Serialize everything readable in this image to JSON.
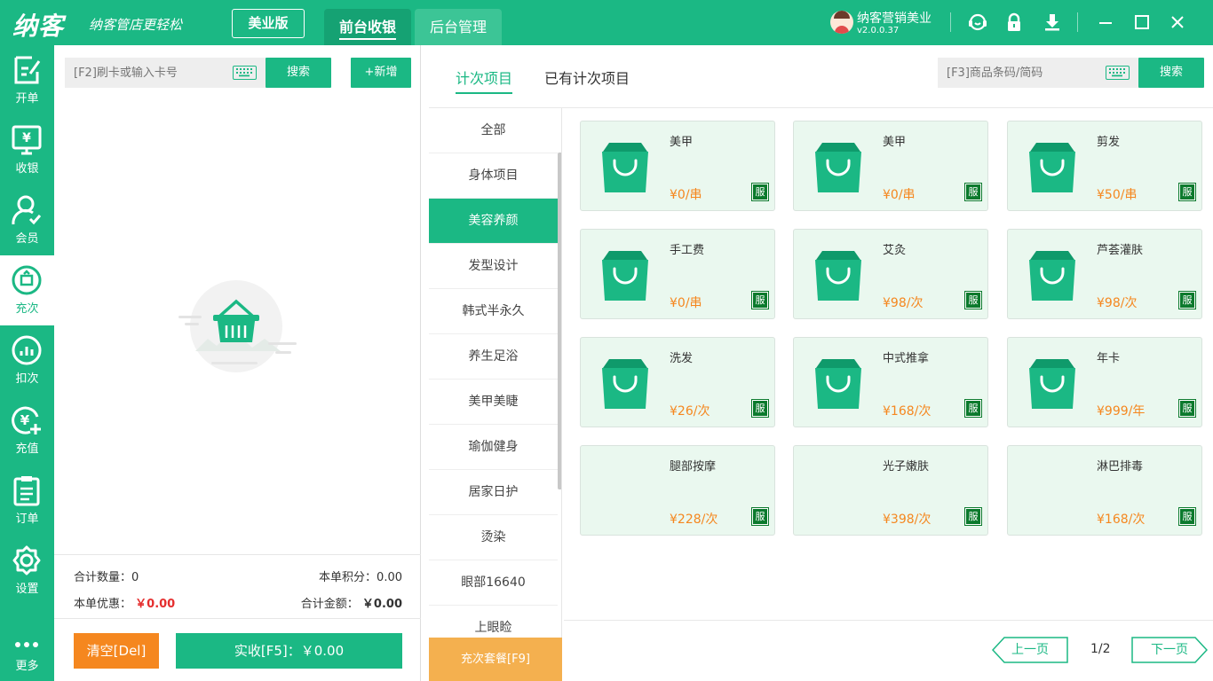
{
  "brand": {
    "logo": "纳客",
    "slogan": "纳客管店更轻松",
    "edition": "美业版"
  },
  "top_tabs": [
    {
      "label": "前台收银"
    },
    {
      "label": "后台管理"
    }
  ],
  "user": {
    "name": "纳客营销美业",
    "version": "v2.0.0.37"
  },
  "sidebar": {
    "items": [
      {
        "label": "开单",
        "icon": "edit-icon"
      },
      {
        "label": "收银",
        "icon": "cashier-icon"
      },
      {
        "label": "会员",
        "icon": "member-icon"
      },
      {
        "label": "充次",
        "icon": "recharge-times-icon"
      },
      {
        "label": "扣次",
        "icon": "deduct-icon"
      },
      {
        "label": "充值",
        "icon": "topup-icon"
      },
      {
        "label": "订单",
        "icon": "order-icon"
      },
      {
        "label": "设置",
        "icon": "gear-icon"
      },
      {
        "label": "更多",
        "icon": "more-icon"
      }
    ]
  },
  "member_search": {
    "placeholder": "[F2]刷卡或输入卡号",
    "search_label": "搜索",
    "add_label": "+新增"
  },
  "summary": {
    "count_label": "合计数量：",
    "count_value": "0",
    "points_label": "本单积分：",
    "points_value": "0.00",
    "discount_label": "本单优惠：",
    "discount_value": "￥0.00",
    "total_label": "合计金额：",
    "total_value": "￥0.00"
  },
  "actions": {
    "clear_label": "清空[Del]",
    "pay_label": "实收[F5]：￥0.00"
  },
  "sub_tabs": [
    {
      "label": "计次项目"
    },
    {
      "label": "已有计次项目"
    }
  ],
  "goods_search": {
    "placeholder": "[F3]商品条码/简码",
    "search_label": "搜索"
  },
  "categories": [
    "全部",
    "身体项目",
    "美容养颜",
    "发型设计",
    "韩式半永久",
    "养生足浴",
    "美甲美睫",
    "瑜伽健身",
    "居家日护",
    "烫染",
    "眼部16640",
    "上眼睑"
  ],
  "package_button": "充次套餐[F9]",
  "products": [
    {
      "name": "美甲",
      "price": "¥0/串",
      "tag": "服",
      "has_image": true
    },
    {
      "name": "美甲",
      "price": "¥0/串",
      "tag": "服",
      "has_image": true
    },
    {
      "name": "剪发",
      "price": "¥50/串",
      "tag": "服",
      "has_image": true
    },
    {
      "name": "手工费",
      "price": "¥0/串",
      "tag": "服",
      "has_image": true
    },
    {
      "name": "艾灸",
      "price": "¥98/次",
      "tag": "服",
      "has_image": true
    },
    {
      "name": "芦荟灌肤",
      "price": "¥98/次",
      "tag": "服",
      "has_image": true
    },
    {
      "name": "洗发",
      "price": "¥26/次",
      "tag": "服",
      "has_image": true
    },
    {
      "name": "中式推拿",
      "price": "¥168/次",
      "tag": "服",
      "has_image": true
    },
    {
      "name": "年卡",
      "price": "¥999/年",
      "tag": "服",
      "has_image": true
    },
    {
      "name": "腿部按摩",
      "price": "¥228/次",
      "tag": "服",
      "has_image": false
    },
    {
      "name": "光子嫩肤",
      "price": "¥398/次",
      "tag": "服",
      "has_image": false
    },
    {
      "name": "淋巴排毒",
      "price": "¥168/次",
      "tag": "服",
      "has_image": false
    }
  ],
  "pager": {
    "prev_label": "上一页",
    "next_label": "下一页",
    "page_text": "1/2"
  },
  "colors": {
    "primary": "#1bb884",
    "orange": "#f5871f",
    "price": "#f5871f",
    "tag": "#0b7a2d",
    "package": "#f4b04f",
    "red": "#e52e2e"
  }
}
